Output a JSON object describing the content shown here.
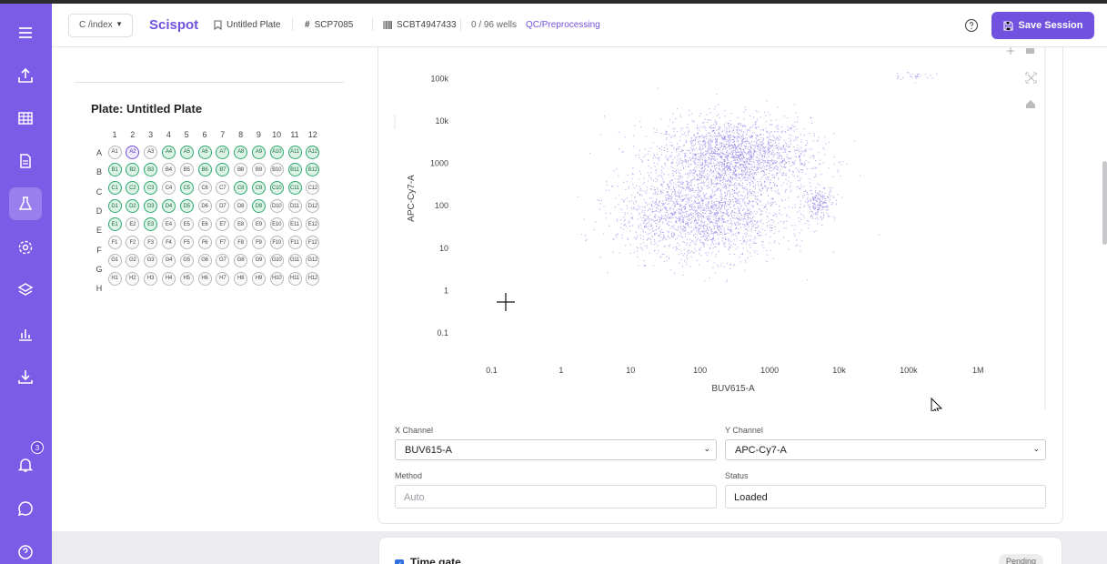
{
  "topbar": {
    "index_select": "C /index",
    "logo": "Scispot",
    "plate_name": "Untitled Plate",
    "plate_id": "SCP7085",
    "barcode": "SCBT4947433",
    "wells_count": "0 / 96 wells",
    "stage": "QC/Preprocessing",
    "save_label": "Save Session"
  },
  "sidebar": {
    "items": [
      {
        "icon": "menu-icon"
      },
      {
        "icon": "upload-icon"
      },
      {
        "icon": "table-icon"
      },
      {
        "icon": "document-icon"
      },
      {
        "icon": "flask-icon",
        "active": true
      },
      {
        "icon": "gear-icon"
      },
      {
        "icon": "layers-icon"
      },
      {
        "icon": "bar-chart-icon"
      },
      {
        "icon": "download-icon"
      },
      {
        "icon": "bell-icon"
      },
      {
        "icon": "chat-icon"
      },
      {
        "icon": "help-icon"
      }
    ],
    "notification_count": "3"
  },
  "plate": {
    "title": "Plate: Untitled Plate",
    "columns": [
      "1",
      "2",
      "3",
      "4",
      "5",
      "6",
      "7",
      "8",
      "9",
      "10",
      "11",
      "12"
    ],
    "rows": [
      "A",
      "B",
      "C",
      "D",
      "E",
      "F",
      "G",
      "H"
    ],
    "selected_wells": [
      "A4",
      "A5",
      "A6",
      "A7",
      "A8",
      "A9",
      "A10",
      "A11",
      "A12",
      "B1",
      "B2",
      "B3",
      "B6",
      "B7",
      "B11",
      "B12",
      "C1",
      "C2",
      "C3",
      "C5",
      "C8",
      "C9",
      "C10",
      "C11",
      "D1",
      "D2",
      "D3",
      "D4",
      "D5",
      "D9",
      "E1",
      "E3"
    ],
    "current_well": "A2"
  },
  "chart_data": {
    "type": "scatter",
    "xlabel": "BUV615-A",
    "ylabel": "APC-Cy7-A",
    "xscale": "log",
    "yscale": "log",
    "xlim": [
      0.05,
      2000000
    ],
    "ylim": [
      0.05,
      200000
    ],
    "xticks": [
      {
        "value": 0.1,
        "label": "0.1"
      },
      {
        "value": 1,
        "label": "1"
      },
      {
        "value": 10,
        "label": "10"
      },
      {
        "value": 100,
        "label": "100"
      },
      {
        "value": 1000,
        "label": "1000"
      },
      {
        "value": 10000,
        "label": "10k"
      },
      {
        "value": 100000,
        "label": "100k"
      },
      {
        "value": 1000000,
        "label": "1M"
      }
    ],
    "yticks": [
      {
        "value": 0.1,
        "label": "0.1"
      },
      {
        "value": 1,
        "label": "1"
      },
      {
        "value": 10,
        "label": "10"
      },
      {
        "value": 100,
        "label": "100"
      },
      {
        "value": 1000,
        "label": "1000"
      },
      {
        "value": 10000,
        "label": "10k"
      },
      {
        "value": 100000,
        "label": "100k"
      }
    ],
    "point_color": "#7b6be0",
    "clusters": [
      {
        "x_center": 300,
        "y_center": 1500,
        "x_spread_decades": 0.55,
        "y_spread_decades": 0.45,
        "count": 2200
      },
      {
        "x_center": 100,
        "y_center": 60,
        "x_spread_decades": 0.6,
        "y_spread_decades": 0.5,
        "count": 2000
      },
      {
        "x_center": 5000,
        "y_center": 120,
        "x_spread_decades": 0.12,
        "y_spread_decades": 0.2,
        "count": 220
      },
      {
        "x_center": 120000,
        "y_center": 120000,
        "x_spread_decades": 0.15,
        "y_spread_decades": 0.05,
        "count": 30
      }
    ],
    "grid": false
  },
  "controls": {
    "x_channel_label": "X Channel",
    "x_channel_value": "BUV615-A",
    "y_channel_label": "Y Channel",
    "y_channel_value": "APC-Cy7-A",
    "method_label": "Method",
    "method_placeholder": "Auto",
    "status_label": "Status",
    "status_value": "Loaded"
  },
  "time_gate": {
    "title": "Time gate",
    "status": "Pending"
  }
}
